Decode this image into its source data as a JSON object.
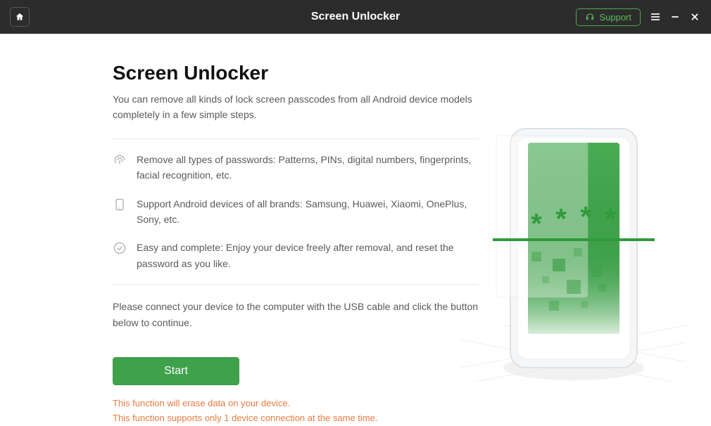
{
  "titlebar": {
    "title": "Screen Unlocker",
    "support_label": "Support"
  },
  "main": {
    "title": "Screen Unlocker",
    "subtitle": "You can remove all kinds of lock screen passcodes from all Android device models completely in a few simple steps.",
    "features": [
      "Remove all types of passwords: Patterns, PINs, digital numbers, fingerprints, facial recognition, etc.",
      "Support Android devices of all brands: Samsung, Huawei, Xiaomi, OnePlus, Sony, etc.",
      "Easy and complete: Enjoy your device freely after removal, and reset the password as you like."
    ],
    "instruction": "Please connect your device to the computer with the USB cable and click the button below to continue.",
    "start_label": "Start",
    "warnings": [
      "This function will erase data on your device.",
      "This function supports only 1 device connection at the same time."
    ]
  }
}
